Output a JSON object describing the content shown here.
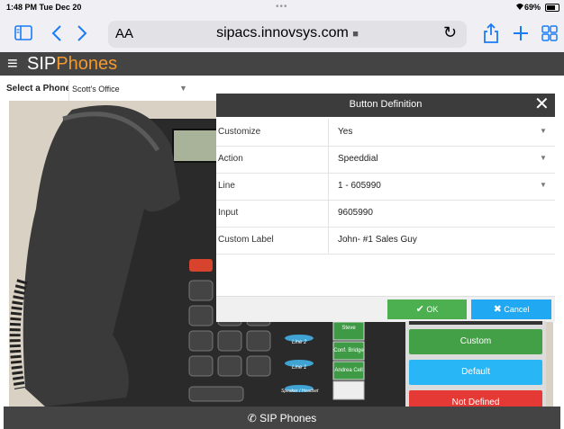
{
  "status_bar": {
    "time": "1:48 PM  Tue Dec 20",
    "battery": "69%"
  },
  "browser": {
    "text_size_label": "AA",
    "url": "sipacs.innovsys.com"
  },
  "app": {
    "brand_sip": "SIP",
    "brand_phones": "Phones",
    "brand_phones_color": "#f29a2e"
  },
  "phone_select": {
    "label": "Select a Phone",
    "value": "Scott's Office"
  },
  "dialog": {
    "title": "Button Definition",
    "rows": [
      {
        "label": "Customize",
        "value": "Yes"
      },
      {
        "label": "Action",
        "value": "Speeddial"
      },
      {
        "label": "Line",
        "value": "1 - 605990"
      },
      {
        "label": "Input",
        "value": "9605990"
      },
      {
        "label": "Custom Label",
        "value": "John- #1 Sales Guy"
      }
    ],
    "ok_label": "OK",
    "cancel_label": "Cancel"
  },
  "phone_keys": {
    "line2": "Line 2",
    "line1": "Line 1",
    "speaker": "Speaker / Headset",
    "steve": "Steve",
    "conf": "Conf. Bridge",
    "andrea": "Andrea Cell"
  },
  "button_panel": {
    "custom": "Custom",
    "default": "Default",
    "not_defined": "Not Defined"
  },
  "footer": {
    "label": "SIP Phones"
  },
  "colors": {
    "ok": "#4caf50",
    "cancel": "#20a8f2",
    "custom": "#43a047",
    "default": "#29b6f6",
    "not_defined": "#e53935"
  }
}
